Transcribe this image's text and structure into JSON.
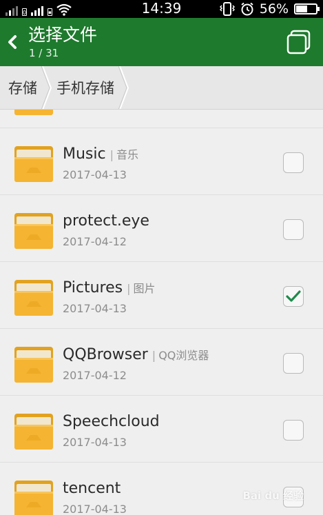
{
  "status_bar": {
    "time": "14:39",
    "battery_percent_text": "56%",
    "battery_level": 0.56,
    "sim_tag": "0"
  },
  "header": {
    "title": "选择文件",
    "selection_count": "1 / 31",
    "accent_color": "#1e7a2d"
  },
  "breadcrumb": [
    "存储",
    "手机存储"
  ],
  "files": [
    {
      "name": "",
      "alias": "",
      "date": "",
      "checked": false
    },
    {
      "name": "Music",
      "alias": "音乐",
      "date": "2017-04-13",
      "checked": false
    },
    {
      "name": "protect.eye",
      "alias": "",
      "date": "2017-04-12",
      "checked": false
    },
    {
      "name": "Pictures",
      "alias": "图片",
      "date": "2017-04-13",
      "checked": true
    },
    {
      "name": "QQBrowser",
      "alias": "QQ浏览器",
      "date": "2017-04-12",
      "checked": false
    },
    {
      "name": "Speechcloud",
      "alias": "",
      "date": "2017-04-13",
      "checked": false
    },
    {
      "name": "tencent",
      "alias": "",
      "date": "2017-04-13",
      "checked": false
    }
  ],
  "watermark": "Bai du 经验",
  "icons": {
    "back": "chevron-left-icon",
    "select_all": "select-all-icon",
    "folder": "folder-icon",
    "check": "checkmark-icon"
  }
}
